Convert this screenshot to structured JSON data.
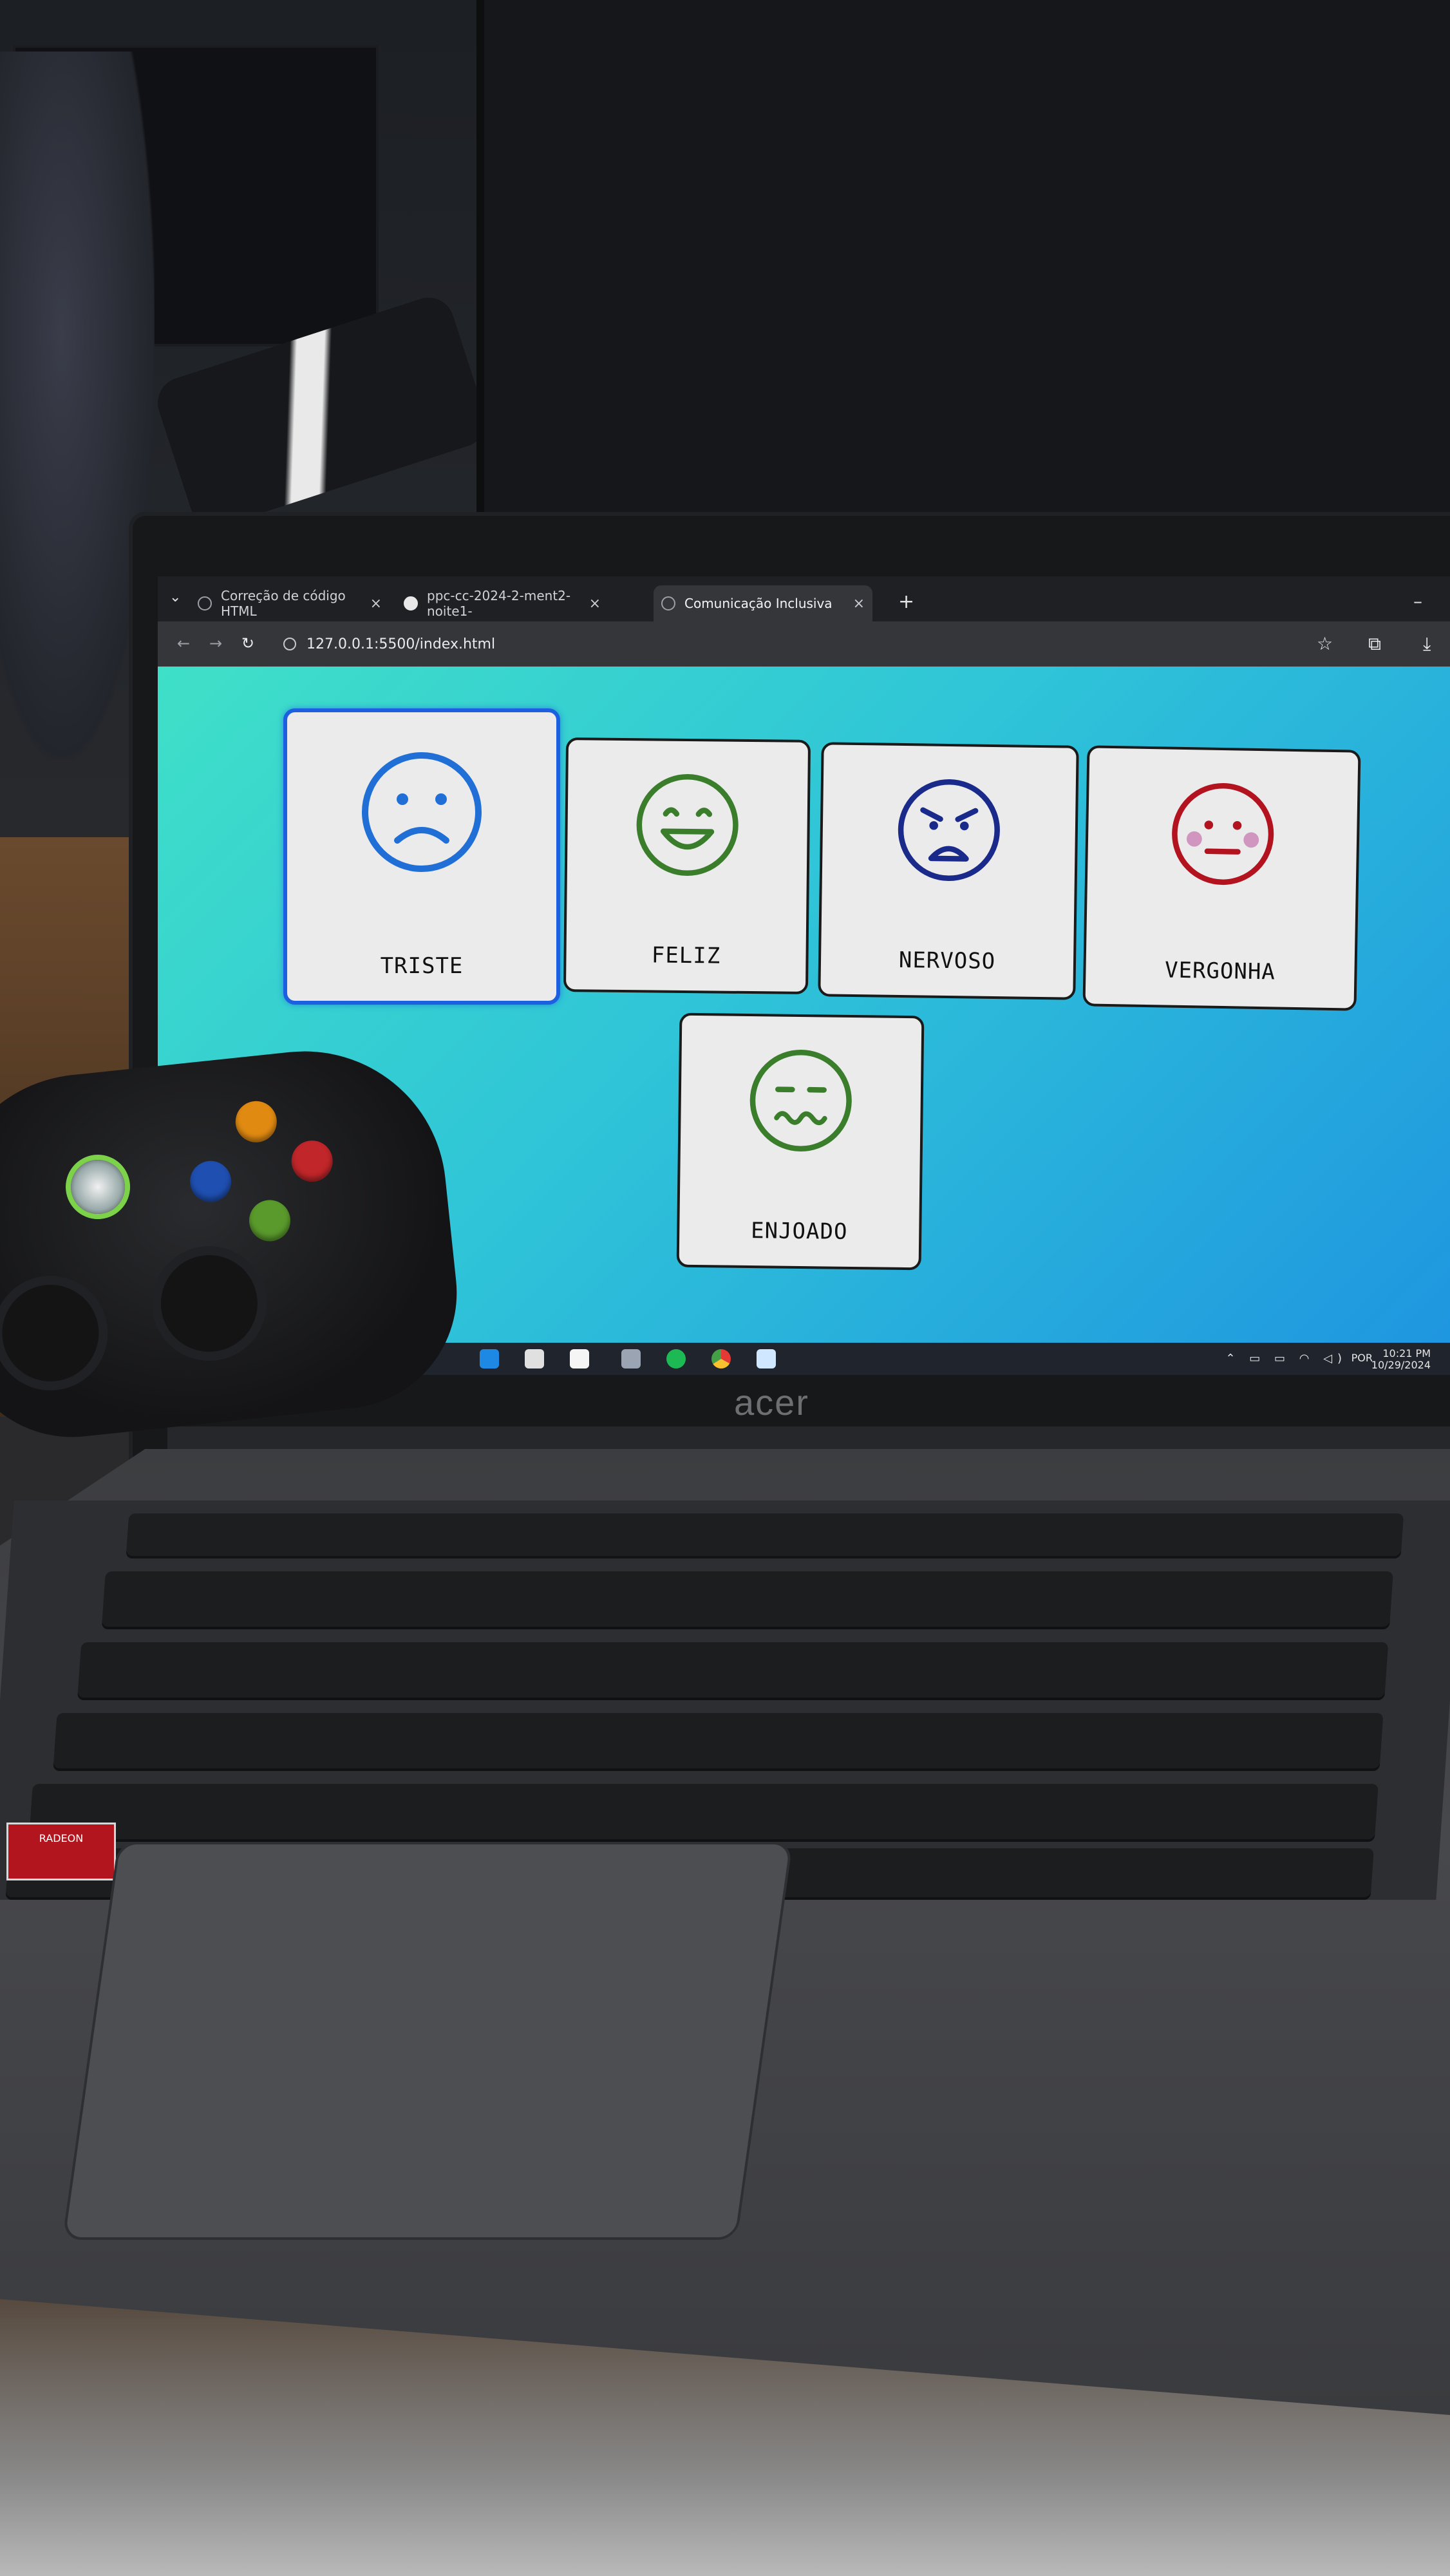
{
  "browser": {
    "tabs": [
      {
        "label": "Correção de código HTML",
        "active": false
      },
      {
        "label": "ppc-cc-2024-2-ment2-noite1-",
        "active": false
      },
      {
        "label": "Comunicação Inclusiva",
        "active": true
      }
    ],
    "close_glyph": "×",
    "new_tab_glyph": "+",
    "url": "127.0.0.1:5500/index.html"
  },
  "page": {
    "background_gradient": [
      "#3fe0c8",
      "#1f96e0"
    ],
    "emotions": [
      {
        "label": "TRISTE",
        "color": "#1f6fd6",
        "expression": "sad",
        "selected": true
      },
      {
        "label": "FELIZ",
        "color": "#3a7d2a",
        "expression": "happy",
        "selected": false
      },
      {
        "label": "NERVOSO",
        "color": "#1a2a8a",
        "expression": "angry",
        "selected": false
      },
      {
        "label": "VERGONHA",
        "color": "#b3121f",
        "expression": "embarrassed",
        "selected": false
      },
      {
        "label": "ENJOADO",
        "color": "#3a7d2a",
        "expression": "sick",
        "selected": false
      }
    ]
  },
  "taskbar": {
    "language": "POR",
    "time": "10:21 PM",
    "date": "10/29/2024"
  },
  "laptop": {
    "brand": "acer",
    "sticker": "RADEON"
  }
}
